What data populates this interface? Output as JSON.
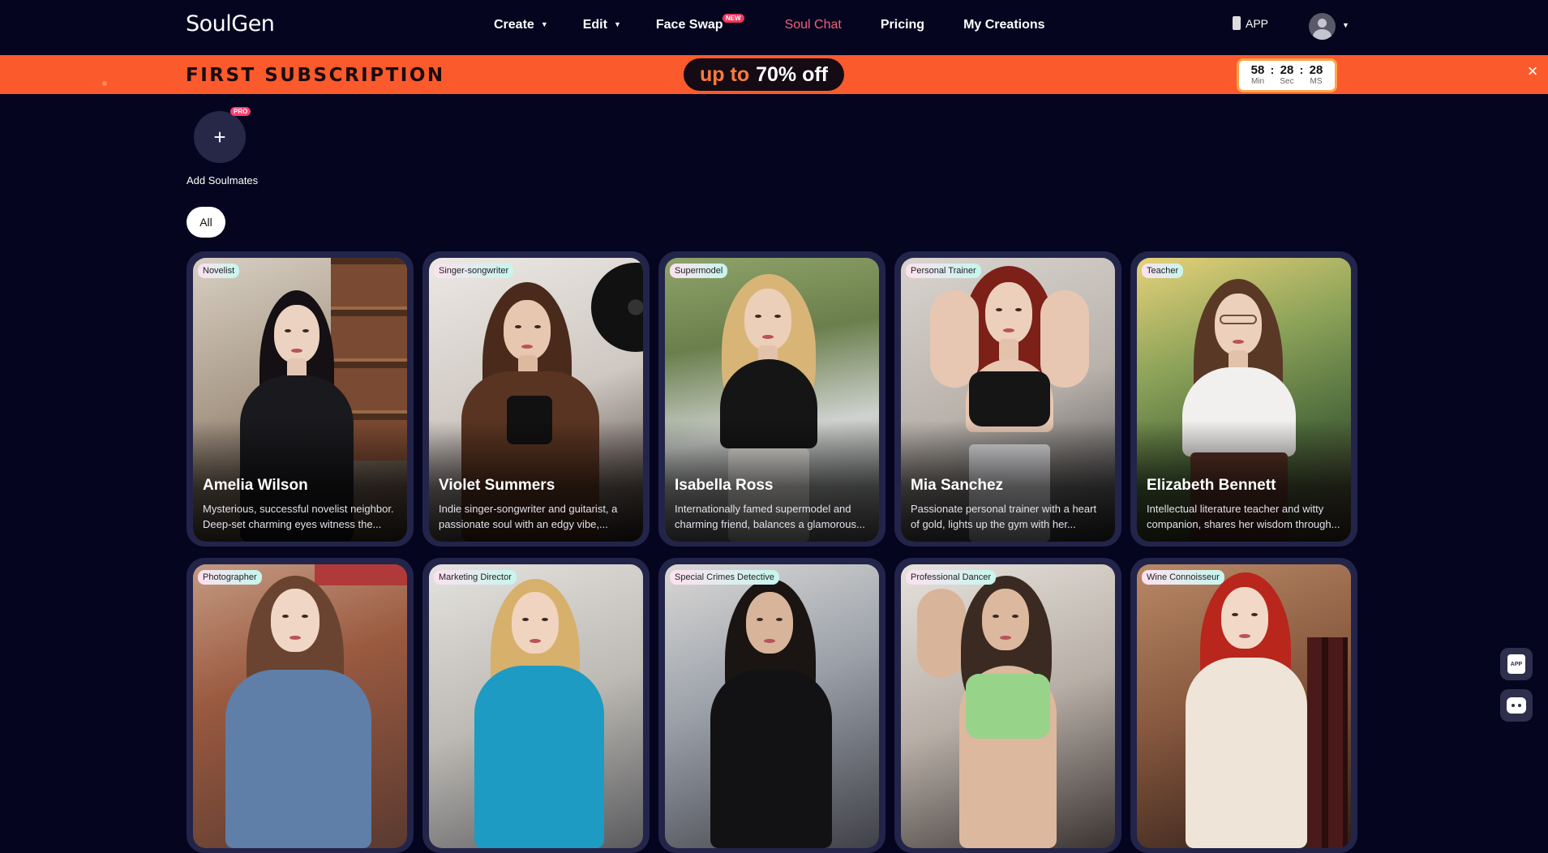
{
  "header": {
    "logo": "SoulGen",
    "nav": [
      {
        "label": "Create",
        "has_caret": true
      },
      {
        "label": "Edit",
        "has_caret": true
      },
      {
        "label": "Face Swap",
        "badge": "NEW"
      },
      {
        "label": "Soul Chat",
        "active": true
      },
      {
        "label": "Pricing"
      },
      {
        "label": "My Creations"
      }
    ],
    "app_label": "APP",
    "accent_color": "#f0607a"
  },
  "promo": {
    "title": "FIRST SUBSCRIPTION",
    "pill_upto": "up to",
    "pill_off": "70% off",
    "timer": {
      "min": "58",
      "sec": "28",
      "ms": "28",
      "min_label": "Min",
      "sec_label": "Sec",
      "ms_label": "MS"
    },
    "close": "×",
    "bg_color": "#fb5a2c"
  },
  "soulmates": {
    "add_label": "Add Soulmates",
    "pro_badge": "PRO",
    "plus": "+"
  },
  "filters": {
    "all": "All"
  },
  "cards": [
    {
      "tag": "Novelist",
      "name": "Amelia Wilson",
      "desc": "Mysterious, successful novelist neighbor. Deep-set charming eyes witness the..."
    },
    {
      "tag": "Singer-songwriter",
      "name": "Violet Summers",
      "desc": "Indie singer-songwriter and guitarist, a passionate soul with an edgy vibe,..."
    },
    {
      "tag": "Supermodel",
      "name": "Isabella Ross",
      "desc": "Internationally famed supermodel and charming friend, balances a glamorous..."
    },
    {
      "tag": "Personal Trainer",
      "name": "Mia Sanchez",
      "desc": "Passionate personal trainer with a heart of gold, lights up the gym with her..."
    },
    {
      "tag": "Teacher",
      "name": "Elizabeth Bennett",
      "desc": "Intellectual literature teacher and witty companion, shares her wisdom through..."
    },
    {
      "tag": "Photographer",
      "name": "",
      "desc": ""
    },
    {
      "tag": "Marketing Director",
      "name": "",
      "desc": ""
    },
    {
      "tag": "Special Crimes Detective",
      "name": "",
      "desc": ""
    },
    {
      "tag": "Professional Dancer",
      "name": "",
      "desc": ""
    },
    {
      "tag": "Wine Connoisseur",
      "name": "",
      "desc": ""
    }
  ],
  "floating": {
    "app_icon_text": "APP"
  }
}
